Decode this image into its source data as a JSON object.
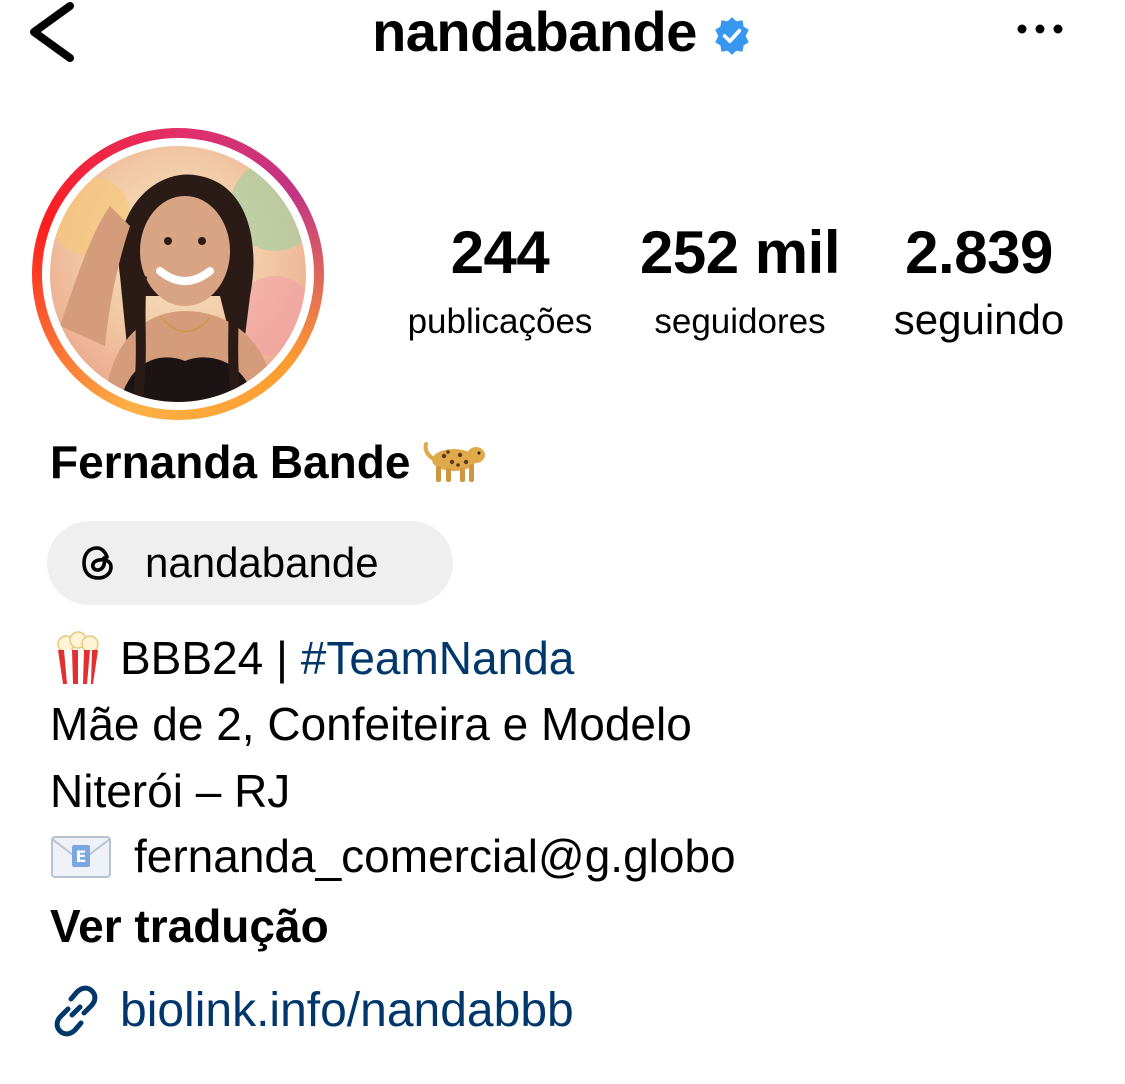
{
  "header": {
    "username": "nandabande",
    "verified": true,
    "accent_color": "#3897f0"
  },
  "profile": {
    "display_name": "Fernanda Bande",
    "name_emoji": "leopard-icon",
    "avatar": "profile-photo"
  },
  "stats": {
    "posts": {
      "value": "244",
      "label": "publicações"
    },
    "followers": {
      "value": "252 mil",
      "label": "seguidores"
    },
    "following": {
      "value": "2.839",
      "label": "seguindo"
    }
  },
  "threads": {
    "handle": "nandabande",
    "icon": "threads-icon"
  },
  "bio": {
    "line1_prefix": "BBB24 | ",
    "line1_hashtag": "#TeamNanda",
    "line2": "Mãe de 2, Confeiteira e Modelo",
    "line3": "Niterói – RJ",
    "line4": "fernanda_comercial@g.globo",
    "translate": "Ver tradução"
  },
  "link": {
    "text": "biolink.info/nandabbb",
    "color": "#00376b"
  }
}
